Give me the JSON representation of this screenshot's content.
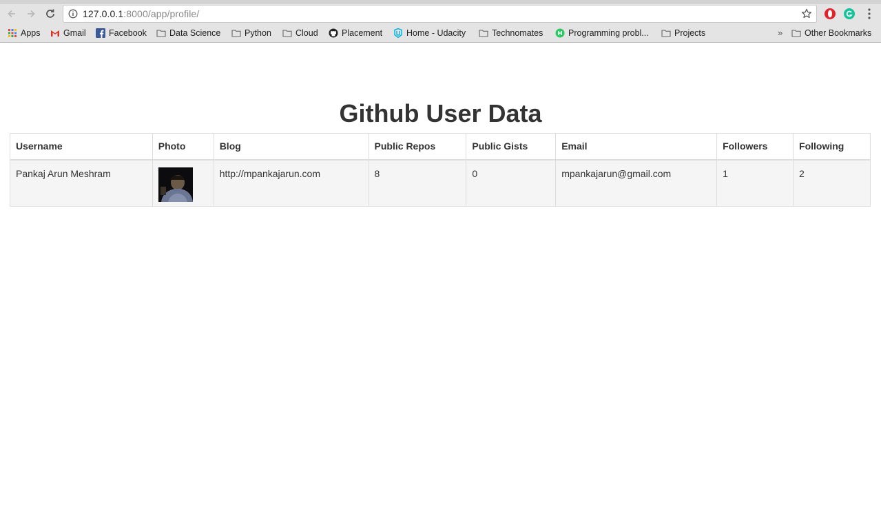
{
  "browser": {
    "url_host": "127.0.0.1",
    "url_rest": ":8000/app/profile/"
  },
  "bookmarks": [
    {
      "label": "Apps",
      "icon": "apps-grid-icon"
    },
    {
      "label": "Gmail",
      "icon": "gmail-icon"
    },
    {
      "label": "Facebook",
      "icon": "facebook-icon"
    },
    {
      "label": "Data Science",
      "icon": "folder-icon"
    },
    {
      "label": "Python",
      "icon": "folder-icon"
    },
    {
      "label": "Cloud",
      "icon": "folder-icon"
    },
    {
      "label": "Placement",
      "icon": "github-icon"
    },
    {
      "label": "Home - Udacity",
      "icon": "udacity-icon"
    },
    {
      "label": "Technomates",
      "icon": "folder-icon"
    },
    {
      "label": "Programming probl...",
      "icon": "hackerrank-icon"
    },
    {
      "label": "Projects",
      "icon": "folder-icon"
    },
    {
      "label": "Other Bookmarks",
      "icon": "folder-icon"
    }
  ],
  "page": {
    "title": "Github User Data"
  },
  "table": {
    "headers": [
      "Username",
      "Photo",
      "Blog",
      "Public Repos",
      "Public Gists",
      "Email",
      "Followers",
      "Following"
    ],
    "rows": [
      {
        "username": "Pankaj Arun Meshram",
        "photo": "avatar-photo",
        "blog": "http://mpankajarun.com",
        "public_repos": "8",
        "public_gists": "0",
        "email": "mpankajarun@gmail.com",
        "followers": "1",
        "following": "2"
      }
    ]
  },
  "colors": {
    "heading_text": "#333333",
    "row_background": "#f5f5f5",
    "table_border": "#dddddd"
  }
}
